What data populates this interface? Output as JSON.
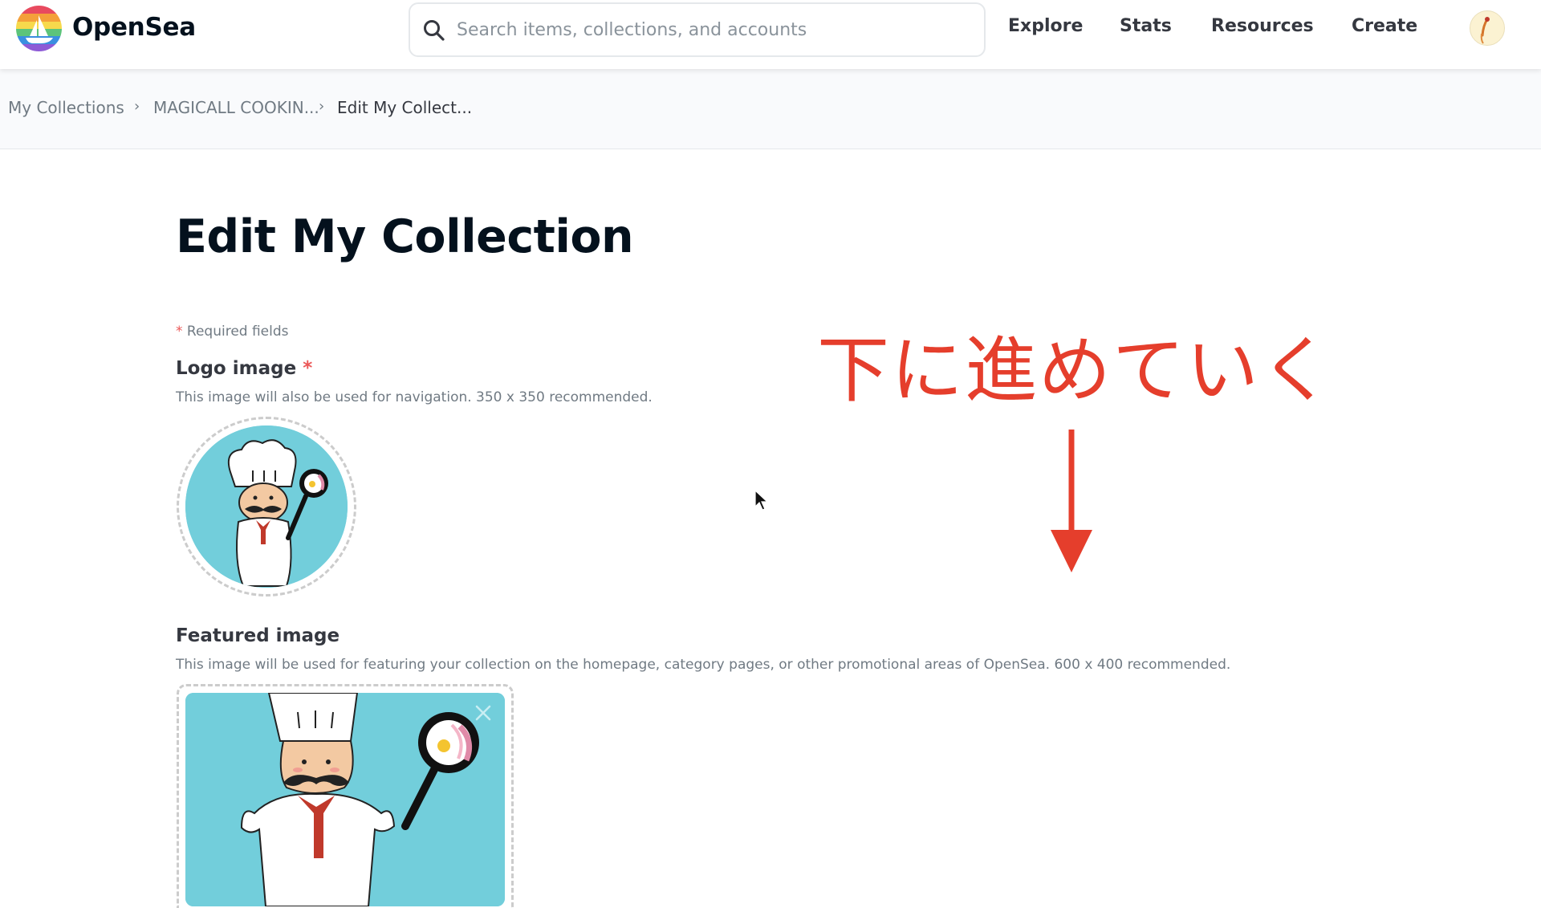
{
  "header": {
    "brand": "OpenSea",
    "search_placeholder": "Search items, collections, and accounts",
    "nav": [
      "Explore",
      "Stats",
      "Resources",
      "Create"
    ]
  },
  "breadcrumb": [
    "My Collections",
    "MAGICALL COOKIN...",
    "Edit My Collect..."
  ],
  "page": {
    "title": "Edit My Collection",
    "required_note": "Required fields",
    "required_mark": "*"
  },
  "logo_field": {
    "label": "Logo image",
    "description": "This image will also be used for navigation. 350 x 350 recommended."
  },
  "featured_field": {
    "label": "Featured image",
    "description": "This image will be used for featuring your collection on the homepage, category pages, or other promotional areas of OpenSea. 600 x 400 recommended."
  },
  "annotation": {
    "text": "下に進めていく"
  },
  "icons": {
    "search": "search-icon",
    "close": "close-icon",
    "arrow": "arrow-down-icon",
    "cursor": "mouse-cursor-icon"
  },
  "colors": {
    "brand_text": "#04111d",
    "required_star": "#eb5757",
    "annotation_red": "#e53e2c",
    "image_background": "#72cedb"
  }
}
